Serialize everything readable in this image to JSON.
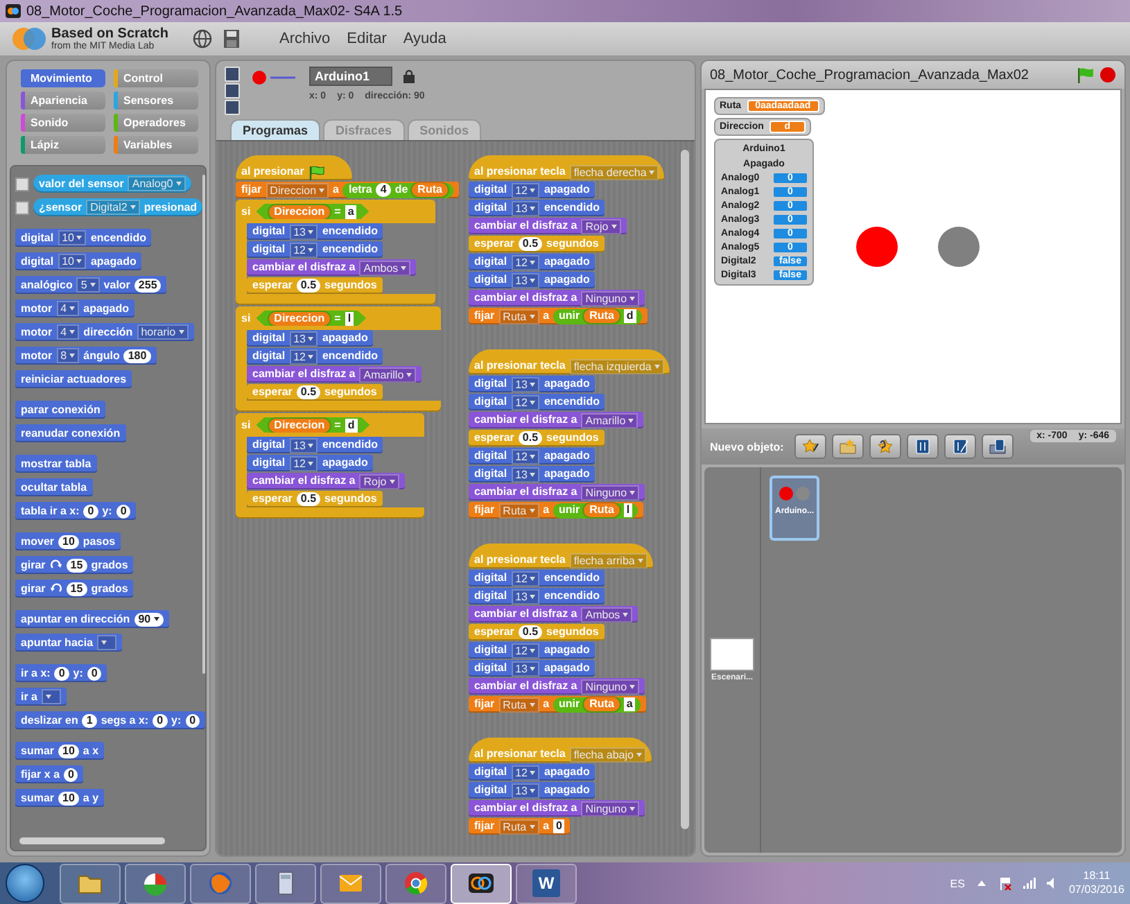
{
  "window": {
    "title": "08_Motor_Coche_Programacion_Avanzada_Max02- S4A 1.5"
  },
  "menubar": {
    "logo_title": "Based on Scratch",
    "logo_subtitle": "from the MIT Media Lab",
    "menus": [
      "Archivo",
      "Editar",
      "Ayuda"
    ]
  },
  "categories": [
    {
      "label": "Movimiento",
      "color": "#4a6cd4",
      "selected": true
    },
    {
      "label": "Control",
      "color": "#e1a91a",
      "selected": false
    },
    {
      "label": "Apariencia",
      "color": "#8a55d7",
      "selected": false
    },
    {
      "label": "Sensores",
      "color": "#2ca5e2",
      "selected": false
    },
    {
      "label": "Sonido",
      "color": "#cf4ad9",
      "selected": false
    },
    {
      "label": "Operadores",
      "color": "#5cb712",
      "selected": false
    },
    {
      "label": "Lápiz",
      "color": "#0e9a6c",
      "selected": false
    },
    {
      "label": "Variables",
      "color": "#ee7d16",
      "selected": false
    }
  ],
  "palette": [
    [
      {
        "kind": "reporter",
        "color": "#2ca5e2",
        "checked": false,
        "parts": [
          {
            "kind": "label",
            "text": "valor del sensor"
          },
          {
            "kind": "drop",
            "text": "Analog0"
          }
        ]
      },
      {
        "kind": "reporter",
        "color": "#2ca5e2",
        "checked": false,
        "parts": [
          {
            "kind": "label",
            "text": "¿sensor"
          },
          {
            "kind": "drop",
            "text": "Digital2"
          },
          {
            "kind": "label",
            "text": "presionad"
          }
        ]
      }
    ],
    [
      {
        "kind": "stack",
        "color": "#4a6cd4",
        "parts": [
          {
            "kind": "label",
            "text": "digital"
          },
          {
            "kind": "drop",
            "text": "10"
          },
          {
            "kind": "label",
            "text": "encendido"
          }
        ]
      },
      {
        "kind": "stack",
        "color": "#4a6cd4",
        "parts": [
          {
            "kind": "label",
            "text": "digital"
          },
          {
            "kind": "drop",
            "text": "10"
          },
          {
            "kind": "label",
            "text": "apagado"
          }
        ]
      },
      {
        "kind": "stack",
        "color": "#4a6cd4",
        "parts": [
          {
            "kind": "label",
            "text": "analógico"
          },
          {
            "kind": "drop",
            "text": "5"
          },
          {
            "kind": "label",
            "text": "valor"
          },
          {
            "kind": "num",
            "text": "255"
          }
        ]
      },
      {
        "kind": "stack",
        "color": "#4a6cd4",
        "parts": [
          {
            "kind": "label",
            "text": "motor"
          },
          {
            "kind": "drop",
            "text": "4"
          },
          {
            "kind": "label",
            "text": "apagado"
          }
        ]
      },
      {
        "kind": "stack",
        "color": "#4a6cd4",
        "parts": [
          {
            "kind": "label",
            "text": "motor"
          },
          {
            "kind": "drop",
            "text": "4"
          },
          {
            "kind": "label",
            "text": "dirección"
          },
          {
            "kind": "drop",
            "text": "horario"
          }
        ]
      },
      {
        "kind": "stack",
        "color": "#4a6cd4",
        "parts": [
          {
            "kind": "label",
            "text": "motor"
          },
          {
            "kind": "drop",
            "text": "8"
          },
          {
            "kind": "label",
            "text": "ángulo"
          },
          {
            "kind": "num",
            "text": "180"
          }
        ]
      },
      {
        "kind": "stack",
        "color": "#4a6cd4",
        "parts": [
          {
            "kind": "label",
            "text": "reiniciar actuadores"
          }
        ]
      }
    ],
    [
      {
        "kind": "stack",
        "color": "#4a6cd4",
        "parts": [
          {
            "kind": "label",
            "text": "parar conexión"
          }
        ]
      },
      {
        "kind": "stack",
        "color": "#4a6cd4",
        "parts": [
          {
            "kind": "label",
            "text": "reanudar conexión"
          }
        ]
      }
    ],
    [
      {
        "kind": "stack",
        "color": "#4a6cd4",
        "parts": [
          {
            "kind": "label",
            "text": "mostrar tabla"
          }
        ]
      },
      {
        "kind": "stack",
        "color": "#4a6cd4",
        "parts": [
          {
            "kind": "label",
            "text": "ocultar tabla"
          }
        ]
      },
      {
        "kind": "stack",
        "color": "#4a6cd4",
        "parts": [
          {
            "kind": "label",
            "text": "tabla ir a x:"
          },
          {
            "kind": "num",
            "text": "0"
          },
          {
            "kind": "label",
            "text": "y:"
          },
          {
            "kind": "num",
            "text": "0"
          }
        ]
      }
    ],
    [
      {
        "kind": "stack",
        "color": "#4a6cd4",
        "parts": [
          {
            "kind": "label",
            "text": "mover"
          },
          {
            "kind": "num",
            "text": "10"
          },
          {
            "kind": "label",
            "text": "pasos"
          }
        ]
      },
      {
        "kind": "stack",
        "color": "#4a6cd4",
        "parts": [
          {
            "kind": "label",
            "text": "girar"
          },
          {
            "kind": "turn_cw"
          },
          {
            "kind": "num",
            "text": "15"
          },
          {
            "kind": "label",
            "text": "grados"
          }
        ]
      },
      {
        "kind": "stack",
        "color": "#4a6cd4",
        "parts": [
          {
            "kind": "label",
            "text": "girar"
          },
          {
            "kind": "turn_ccw"
          },
          {
            "kind": "num",
            "text": "15"
          },
          {
            "kind": "label",
            "text": "grados"
          }
        ]
      }
    ],
    [
      {
        "kind": "stack",
        "color": "#4a6cd4",
        "parts": [
          {
            "kind": "label",
            "text": "apuntar en dirección"
          },
          {
            "kind": "numdrop",
            "text": "90"
          }
        ]
      },
      {
        "kind": "stack",
        "color": "#4a6cd4",
        "parts": [
          {
            "kind": "label",
            "text": "apuntar hacia"
          },
          {
            "kind": "drop"
          }
        ]
      }
    ],
    [
      {
        "kind": "stack",
        "color": "#4a6cd4",
        "parts": [
          {
            "kind": "label",
            "text": "ir a x:"
          },
          {
            "kind": "num",
            "text": "0"
          },
          {
            "kind": "label",
            "text": "y:"
          },
          {
            "kind": "num",
            "text": "0"
          }
        ]
      },
      {
        "kind": "stack",
        "color": "#4a6cd4",
        "parts": [
          {
            "kind": "label",
            "text": "ir a"
          },
          {
            "kind": "drop"
          }
        ]
      },
      {
        "kind": "stack",
        "color": "#4a6cd4",
        "parts": [
          {
            "kind": "label",
            "text": "deslizar en"
          },
          {
            "kind": "num",
            "text": "1"
          },
          {
            "kind": "label",
            "text": "segs a x:"
          },
          {
            "kind": "num",
            "text": "0"
          },
          {
            "kind": "label",
            "text": "y:"
          },
          {
            "kind": "num",
            "text": "0"
          }
        ]
      }
    ],
    [
      {
        "kind": "stack",
        "color": "#4a6cd4",
        "parts": [
          {
            "kind": "label",
            "text": "sumar"
          },
          {
            "kind": "num",
            "text": "10"
          },
          {
            "kind": "label",
            "text": "a x"
          }
        ]
      },
      {
        "kind": "stack",
        "color": "#4a6cd4",
        "parts": [
          {
            "kind": "label",
            "text": "fijar x a"
          },
          {
            "kind": "num",
            "text": "0"
          }
        ]
      },
      {
        "kind": "stack",
        "color": "#4a6cd4",
        "parts": [
          {
            "kind": "label",
            "text": "sumar"
          },
          {
            "kind": "num",
            "text": "10"
          },
          {
            "kind": "label",
            "text": "a y"
          }
        ]
      }
    ]
  ],
  "sprite": {
    "name": "Arduino1",
    "x": "x: 0",
    "y": "y: 0",
    "direction": "dirección: 90"
  },
  "tabs": [
    {
      "label": "Programas",
      "selected": true
    },
    {
      "label": "Disfraces",
      "selected": false
    },
    {
      "label": "Sonidos",
      "selected": false
    }
  ],
  "script_columns": [
    [
      {
        "blocks": [
          {
            "kind": "hat",
            "color": "#e1a91a",
            "parts": [
              {
                "kind": "label",
                "text": "al presionar"
              },
              {
                "kind": "flag"
              }
            ]
          },
          {
            "kind": "stack",
            "color": "#ee7d16",
            "parts": [
              {
                "kind": "label",
                "text": "fijar"
              },
              {
                "kind": "drop",
                "text": "Direccion"
              },
              {
                "kind": "label",
                "text": "a"
              },
              {
                "kind": "op",
                "parts": [
                  {
                    "kind": "label",
                    "text": "letra"
                  },
                  {
                    "kind": "num",
                    "text": "4"
                  },
                  {
                    "kind": "label",
                    "text": "de"
                  },
                  {
                    "kind": "var",
                    "text": "Ruta"
                  }
                ]
              }
            ]
          },
          {
            "kind": "if",
            "color": "#e1a91a",
            "parts": [
              {
                "kind": "label",
                "text": "si"
              },
              {
                "kind": "bool",
                "parts": [
                  {
                    "kind": "var",
                    "text": "Direccion"
                  },
                  {
                    "kind": "label",
                    "text": "="
                  },
                  {
                    "kind": "str",
                    "text": "a"
                  }
                ]
              }
            ],
            "children": [
              {
                "kind": "stack",
                "color": "#4a6cd4",
                "parts": [
                  {
                    "kind": "label",
                    "text": "digital"
                  },
                  {
                    "kind": "drop",
                    "text": "13"
                  },
                  {
                    "kind": "label",
                    "text": "encendido"
                  }
                ]
              },
              {
                "kind": "stack",
                "color": "#4a6cd4",
                "parts": [
                  {
                    "kind": "label",
                    "text": "digital"
                  },
                  {
                    "kind": "drop",
                    "text": "12"
                  },
                  {
                    "kind": "label",
                    "text": "encendido"
                  }
                ]
              },
              {
                "kind": "stack",
                "color": "#8a55d7",
                "parts": [
                  {
                    "kind": "label",
                    "text": "cambiar el disfraz a"
                  },
                  {
                    "kind": "drop",
                    "text": "Ambos"
                  }
                ]
              },
              {
                "kind": "stack",
                "color": "#e1a91a",
                "parts": [
                  {
                    "kind": "label",
                    "text": "esperar"
                  },
                  {
                    "kind": "num",
                    "text": "0.5"
                  },
                  {
                    "kind": "label",
                    "text": "segundos"
                  }
                ]
              }
            ]
          },
          {
            "kind": "if",
            "color": "#e1a91a",
            "parts": [
              {
                "kind": "label",
                "text": "si"
              },
              {
                "kind": "bool",
                "parts": [
                  {
                    "kind": "var",
                    "text": "Direccion"
                  },
                  {
                    "kind": "label",
                    "text": "="
                  },
                  {
                    "kind": "str",
                    "text": "l"
                  }
                ]
              }
            ],
            "children": [
              {
                "kind": "stack",
                "color": "#4a6cd4",
                "parts": [
                  {
                    "kind": "label",
                    "text": "digital"
                  },
                  {
                    "kind": "drop",
                    "text": "13"
                  },
                  {
                    "kind": "label",
                    "text": "apagado"
                  }
                ]
              },
              {
                "kind": "stack",
                "color": "#4a6cd4",
                "parts": [
                  {
                    "kind": "label",
                    "text": "digital"
                  },
                  {
                    "kind": "drop",
                    "text": "12"
                  },
                  {
                    "kind": "label",
                    "text": "encendido"
                  }
                ]
              },
              {
                "kind": "stack",
                "color": "#8a55d7",
                "parts": [
                  {
                    "kind": "label",
                    "text": "cambiar el disfraz a"
                  },
                  {
                    "kind": "drop",
                    "text": "Amarillo"
                  }
                ]
              },
              {
                "kind": "stack",
                "color": "#e1a91a",
                "parts": [
                  {
                    "kind": "label",
                    "text": "esperar"
                  },
                  {
                    "kind": "num",
                    "text": "0.5"
                  },
                  {
                    "kind": "label",
                    "text": "segundos"
                  }
                ]
              }
            ]
          },
          {
            "kind": "if",
            "color": "#e1a91a",
            "parts": [
              {
                "kind": "label",
                "text": "si"
              },
              {
                "kind": "bool",
                "parts": [
                  {
                    "kind": "var",
                    "text": "Direccion"
                  },
                  {
                    "kind": "label",
                    "text": "="
                  },
                  {
                    "kind": "str",
                    "text": "d"
                  }
                ]
              }
            ],
            "children": [
              {
                "kind": "stack",
                "color": "#4a6cd4",
                "parts": [
                  {
                    "kind": "label",
                    "text": "digital"
                  },
                  {
                    "kind": "drop",
                    "text": "13"
                  },
                  {
                    "kind": "label",
                    "text": "encendido"
                  }
                ]
              },
              {
                "kind": "stack",
                "color": "#4a6cd4",
                "parts": [
                  {
                    "kind": "label",
                    "text": "digital"
                  },
                  {
                    "kind": "drop",
                    "text": "12"
                  },
                  {
                    "kind": "label",
                    "text": "apagado"
                  }
                ]
              },
              {
                "kind": "stack",
                "color": "#8a55d7",
                "parts": [
                  {
                    "kind": "label",
                    "text": "cambiar el disfraz a"
                  },
                  {
                    "kind": "drop",
                    "text": "Rojo"
                  }
                ]
              },
              {
                "kind": "stack",
                "color": "#e1a91a",
                "parts": [
                  {
                    "kind": "label",
                    "text": "esperar"
                  },
                  {
                    "kind": "num",
                    "text": "0.5"
                  },
                  {
                    "kind": "label",
                    "text": "segundos"
                  }
                ]
              }
            ]
          }
        ]
      }
    ],
    [
      {
        "blocks": [
          {
            "kind": "hat",
            "color": "#e1a91a",
            "parts": [
              {
                "kind": "label",
                "text": "al presionar tecla"
              },
              {
                "kind": "drop",
                "text": "flecha derecha"
              }
            ]
          },
          {
            "kind": "stack",
            "color": "#4a6cd4",
            "parts": [
              {
                "kind": "label",
                "text": "digital"
              },
              {
                "kind": "drop",
                "text": "12"
              },
              {
                "kind": "label",
                "text": "apagado"
              }
            ]
          },
          {
            "kind": "stack",
            "color": "#4a6cd4",
            "parts": [
              {
                "kind": "label",
                "text": "digital"
              },
              {
                "kind": "drop",
                "text": "13"
              },
              {
                "kind": "label",
                "text": "encendido"
              }
            ]
          },
          {
            "kind": "stack",
            "color": "#8a55d7",
            "parts": [
              {
                "kind": "label",
                "text": "cambiar el disfraz a"
              },
              {
                "kind": "drop",
                "text": "Rojo"
              }
            ]
          },
          {
            "kind": "stack",
            "color": "#e1a91a",
            "parts": [
              {
                "kind": "label",
                "text": "esperar"
              },
              {
                "kind": "num",
                "text": "0.5"
              },
              {
                "kind": "label",
                "text": "segundos"
              }
            ]
          },
          {
            "kind": "stack",
            "color": "#4a6cd4",
            "parts": [
              {
                "kind": "label",
                "text": "digital"
              },
              {
                "kind": "drop",
                "text": "12"
              },
              {
                "kind": "label",
                "text": "apagado"
              }
            ]
          },
          {
            "kind": "stack",
            "color": "#4a6cd4",
            "parts": [
              {
                "kind": "label",
                "text": "digital"
              },
              {
                "kind": "drop",
                "text": "13"
              },
              {
                "kind": "label",
                "text": "apagado"
              }
            ]
          },
          {
            "kind": "stack",
            "color": "#8a55d7",
            "parts": [
              {
                "kind": "label",
                "text": "cambiar el disfraz a"
              },
              {
                "kind": "drop",
                "text": "Ninguno"
              }
            ]
          },
          {
            "kind": "stack",
            "color": "#ee7d16",
            "parts": [
              {
                "kind": "label",
                "text": "fijar"
              },
              {
                "kind": "drop",
                "text": "Ruta"
              },
              {
                "kind": "label",
                "text": "a"
              },
              {
                "kind": "op",
                "parts": [
                  {
                    "kind": "label",
                    "text": "unir"
                  },
                  {
                    "kind": "var",
                    "text": "Ruta"
                  },
                  {
                    "kind": "str",
                    "text": "d"
                  }
                ]
              }
            ]
          }
        ]
      },
      {
        "blocks": [
          {
            "kind": "hat",
            "color": "#e1a91a",
            "parts": [
              {
                "kind": "label",
                "text": "al presionar tecla"
              },
              {
                "kind": "drop",
                "text": "flecha izquierda"
              }
            ]
          },
          {
            "kind": "stack",
            "color": "#4a6cd4",
            "parts": [
              {
                "kind": "label",
                "text": "digital"
              },
              {
                "kind": "drop",
                "text": "13"
              },
              {
                "kind": "label",
                "text": "apagado"
              }
            ]
          },
          {
            "kind": "stack",
            "color": "#4a6cd4",
            "parts": [
              {
                "kind": "label",
                "text": "digital"
              },
              {
                "kind": "drop",
                "text": "12"
              },
              {
                "kind": "label",
                "text": "encendido"
              }
            ]
          },
          {
            "kind": "stack",
            "color": "#8a55d7",
            "parts": [
              {
                "kind": "label",
                "text": "cambiar el disfraz a"
              },
              {
                "kind": "drop",
                "text": "Amarillo"
              }
            ]
          },
          {
            "kind": "stack",
            "color": "#e1a91a",
            "parts": [
              {
                "kind": "label",
                "text": "esperar"
              },
              {
                "kind": "num",
                "text": "0.5"
              },
              {
                "kind": "label",
                "text": "segundos"
              }
            ]
          },
          {
            "kind": "stack",
            "color": "#4a6cd4",
            "parts": [
              {
                "kind": "label",
                "text": "digital"
              },
              {
                "kind": "drop",
                "text": "12"
              },
              {
                "kind": "label",
                "text": "apagado"
              }
            ]
          },
          {
            "kind": "stack",
            "color": "#4a6cd4",
            "parts": [
              {
                "kind": "label",
                "text": "digital"
              },
              {
                "kind": "drop",
                "text": "13"
              },
              {
                "kind": "label",
                "text": "apagado"
              }
            ]
          },
          {
            "kind": "stack",
            "color": "#8a55d7",
            "parts": [
              {
                "kind": "label",
                "text": "cambiar el disfraz a"
              },
              {
                "kind": "drop",
                "text": "Ninguno"
              }
            ]
          },
          {
            "kind": "stack",
            "color": "#ee7d16",
            "parts": [
              {
                "kind": "label",
                "text": "fijar"
              },
              {
                "kind": "drop",
                "text": "Ruta"
              },
              {
                "kind": "label",
                "text": "a"
              },
              {
                "kind": "op",
                "parts": [
                  {
                    "kind": "label",
                    "text": "unir"
                  },
                  {
                    "kind": "var",
                    "text": "Ruta"
                  },
                  {
                    "kind": "str",
                    "text": "l"
                  }
                ]
              }
            ]
          }
        ]
      },
      {
        "blocks": [
          {
            "kind": "hat",
            "color": "#e1a91a",
            "parts": [
              {
                "kind": "label",
                "text": "al presionar tecla"
              },
              {
                "kind": "drop",
                "text": "flecha arriba"
              }
            ]
          },
          {
            "kind": "stack",
            "color": "#4a6cd4",
            "parts": [
              {
                "kind": "label",
                "text": "digital"
              },
              {
                "kind": "drop",
                "text": "12"
              },
              {
                "kind": "label",
                "text": "encendido"
              }
            ]
          },
          {
            "kind": "stack",
            "color": "#4a6cd4",
            "parts": [
              {
                "kind": "label",
                "text": "digital"
              },
              {
                "kind": "drop",
                "text": "13"
              },
              {
                "kind": "label",
                "text": "encendido"
              }
            ]
          },
          {
            "kind": "stack",
            "color": "#8a55d7",
            "parts": [
              {
                "kind": "label",
                "text": "cambiar el disfraz a"
              },
              {
                "kind": "drop",
                "text": "Ambos"
              }
            ]
          },
          {
            "kind": "stack",
            "color": "#e1a91a",
            "parts": [
              {
                "kind": "label",
                "text": "esperar"
              },
              {
                "kind": "num",
                "text": "0.5"
              },
              {
                "kind": "label",
                "text": "segundos"
              }
            ]
          },
          {
            "kind": "stack",
            "color": "#4a6cd4",
            "parts": [
              {
                "kind": "label",
                "text": "digital"
              },
              {
                "kind": "drop",
                "text": "12"
              },
              {
                "kind": "label",
                "text": "apagado"
              }
            ]
          },
          {
            "kind": "stack",
            "color": "#4a6cd4",
            "parts": [
              {
                "kind": "label",
                "text": "digital"
              },
              {
                "kind": "drop",
                "text": "13"
              },
              {
                "kind": "label",
                "text": "apagado"
              }
            ]
          },
          {
            "kind": "stack",
            "color": "#8a55d7",
            "parts": [
              {
                "kind": "label",
                "text": "cambiar el disfraz a"
              },
              {
                "kind": "drop",
                "text": "Ninguno"
              }
            ]
          },
          {
            "kind": "stack",
            "color": "#ee7d16",
            "parts": [
              {
                "kind": "label",
                "text": "fijar"
              },
              {
                "kind": "drop",
                "text": "Ruta"
              },
              {
                "kind": "label",
                "text": "a"
              },
              {
                "kind": "op",
                "parts": [
                  {
                    "kind": "label",
                    "text": "unir"
                  },
                  {
                    "kind": "var",
                    "text": "Ruta"
                  },
                  {
                    "kind": "str",
                    "text": "a"
                  }
                ]
              }
            ]
          }
        ]
      },
      {
        "blocks": [
          {
            "kind": "hat",
            "color": "#e1a91a",
            "parts": [
              {
                "kind": "label",
                "text": "al presionar tecla"
              },
              {
                "kind": "drop",
                "text": "flecha abajo"
              }
            ]
          },
          {
            "kind": "stack",
            "color": "#4a6cd4",
            "parts": [
              {
                "kind": "label",
                "text": "digital"
              },
              {
                "kind": "drop",
                "text": "12"
              },
              {
                "kind": "label",
                "text": "apagado"
              }
            ]
          },
          {
            "kind": "stack",
            "color": "#4a6cd4",
            "parts": [
              {
                "kind": "label",
                "text": "digital"
              },
              {
                "kind": "drop",
                "text": "13"
              },
              {
                "kind": "label",
                "text": "apagado"
              }
            ]
          },
          {
            "kind": "stack",
            "color": "#8a55d7",
            "parts": [
              {
                "kind": "label",
                "text": "cambiar el disfraz a"
              },
              {
                "kind": "drop",
                "text": "Ninguno"
              }
            ]
          },
          {
            "kind": "stack",
            "color": "#ee7d16",
            "parts": [
              {
                "kind": "label",
                "text": "fijar"
              },
              {
                "kind": "drop",
                "text": "Ruta"
              },
              {
                "kind": "label",
                "text": "a"
              },
              {
                "kind": "str",
                "text": "0"
              }
            ]
          }
        ]
      }
    ]
  ],
  "stage": {
    "title": "08_Motor_Coche_Programacion_Avanzada_Max02",
    "monitors": [
      {
        "label": "Ruta",
        "value": "0aadaadaad"
      },
      {
        "label": "Direccion",
        "value": "d"
      }
    ],
    "sensor_board": {
      "title": "Arduino1",
      "status": "Apagado",
      "rows": [
        {
          "name": "Analog0",
          "value": "0"
        },
        {
          "name": "Analog1",
          "value": "0"
        },
        {
          "name": "Analog2",
          "value": "0"
        },
        {
          "name": "Analog3",
          "value": "0"
        },
        {
          "name": "Analog4",
          "value": "0"
        },
        {
          "name": "Analog5",
          "value": "0"
        },
        {
          "name": "Digital2",
          "value": "false"
        },
        {
          "name": "Digital3",
          "value": "false"
        }
      ]
    },
    "leds": [
      {
        "lit": true
      },
      {
        "lit": false
      }
    ]
  },
  "new_sprite": {
    "label": "Nuevo objeto:",
    "mouse_x": "x: -700",
    "mouse_y": "y: -646",
    "buttons": [
      {
        "kind": "paint"
      },
      {
        "kind": "folder"
      },
      {
        "kind": "random"
      },
      {
        "kind": "board"
      },
      {
        "kind": "board_paint"
      },
      {
        "kind": "board_folder"
      }
    ]
  },
  "sprites": {
    "stage_label": "Escenari...",
    "items": [
      {
        "name": "Arduino...",
        "selected": true
      }
    ]
  },
  "taskbar": {
    "apps": [
      {
        "kind": "folder",
        "selected": false
      },
      {
        "kind": "chart",
        "selected": false
      },
      {
        "kind": "fox",
        "selected": false
      },
      {
        "kind": "calculator",
        "selected": false
      },
      {
        "kind": "mail",
        "selected": false
      },
      {
        "kind": "wheel",
        "selected": false
      },
      {
        "kind": "rings",
        "selected": true
      },
      {
        "kind": "doc",
        "label": "W",
        "selected": false
      }
    ],
    "language": "ES",
    "time": "18:11",
    "date": "07/03/2016"
  }
}
